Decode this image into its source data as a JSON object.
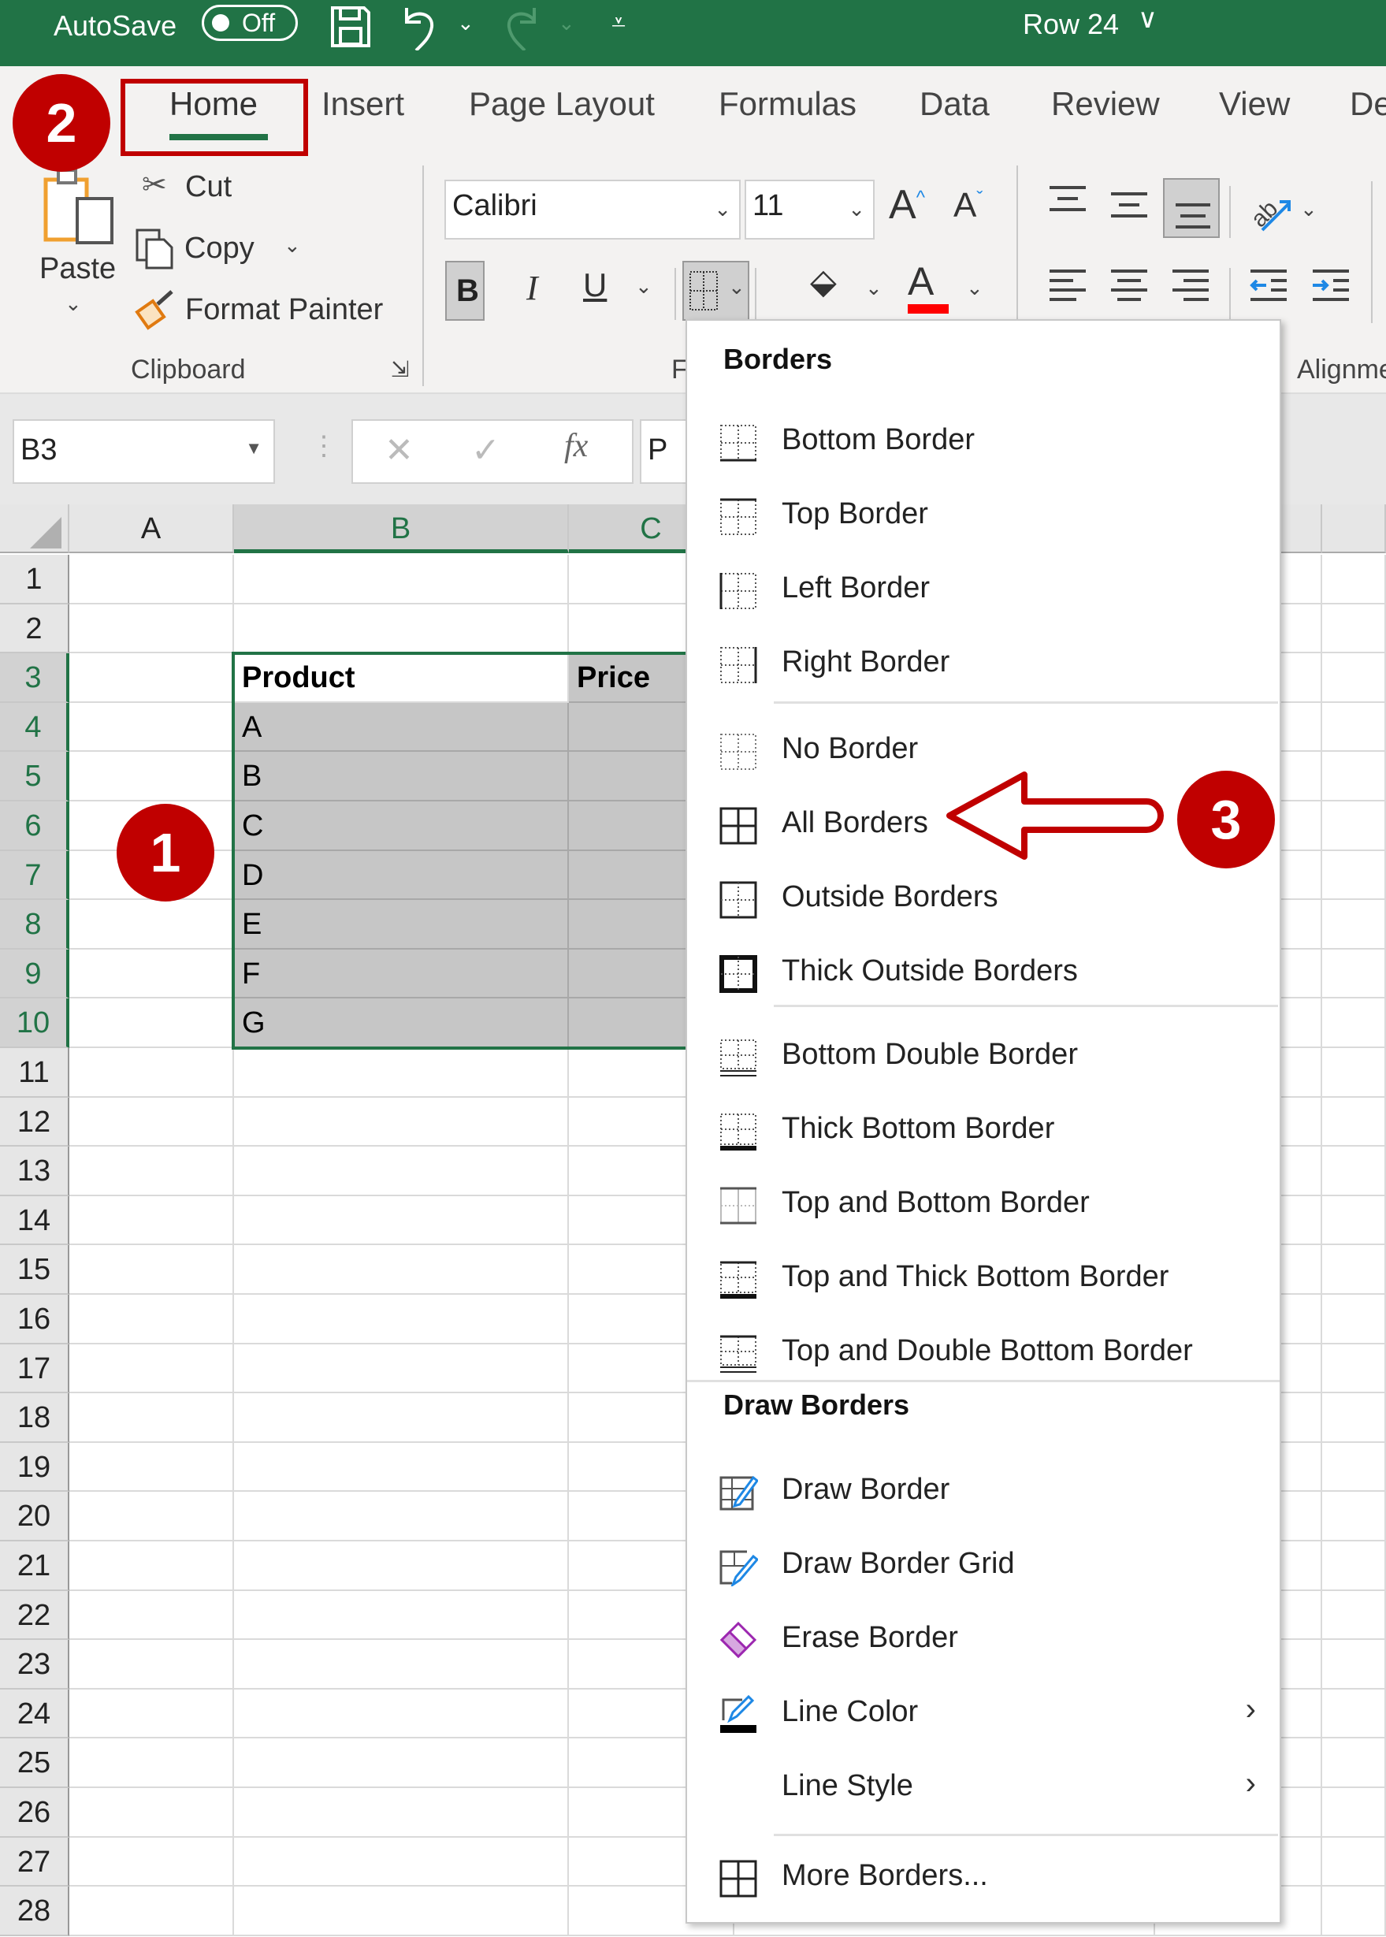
{
  "titlebar": {
    "autosave_label": "AutoSave",
    "autosave_state": "Off",
    "document_name": "Row 24",
    "colors": {
      "bar": "#217346"
    }
  },
  "tabs": [
    {
      "label": "Home",
      "active": true
    },
    {
      "label": "Insert"
    },
    {
      "label": "Page Layout"
    },
    {
      "label": "Formulas"
    },
    {
      "label": "Data"
    },
    {
      "label": "Review"
    },
    {
      "label": "View"
    },
    {
      "label": "De"
    }
  ],
  "ribbon": {
    "clipboard": {
      "paste": "Paste",
      "cut": "Cut",
      "copy": "Copy",
      "format_painter": "Format Painter",
      "group_label": "Clipboard"
    },
    "font": {
      "font_name": "Calibri",
      "font_size": "11",
      "bold": "B",
      "italic": "I",
      "underline": "U",
      "group_label": "F",
      "font_color": "#ff0000"
    },
    "alignment": {
      "group_label": "Alignme"
    }
  },
  "formula_bar": {
    "name_box": "B3",
    "fx": "fx",
    "content": "P"
  },
  "sheet": {
    "columns": [
      "A",
      "B",
      "C"
    ],
    "rows": [
      "1",
      "2",
      "3",
      "4",
      "5",
      "6",
      "7",
      "8",
      "9",
      "10",
      "11",
      "12",
      "13",
      "14",
      "15",
      "16",
      "17",
      "18",
      "19",
      "20",
      "21",
      "22",
      "23",
      "24",
      "25",
      "26",
      "27",
      "28"
    ],
    "table": {
      "header": [
        "Product",
        "Price"
      ],
      "products": [
        "A",
        "B",
        "C",
        "D",
        "E",
        "F",
        "G"
      ]
    }
  },
  "borders_menu": {
    "section1": "Borders",
    "items1": [
      {
        "label": "Bottom Border",
        "icon": "bottom-border-icon"
      },
      {
        "label": "Top Border",
        "icon": "top-border-icon"
      },
      {
        "label": "Left Border",
        "icon": "left-border-icon"
      },
      {
        "label": "Right Border",
        "icon": "right-border-icon"
      }
    ],
    "items2": [
      {
        "label": "No Border",
        "icon": "no-border-icon"
      },
      {
        "label": "All Borders",
        "icon": "all-borders-icon"
      },
      {
        "label": "Outside Borders",
        "icon": "outside-borders-icon"
      },
      {
        "label": "Thick Outside Borders",
        "icon": "thick-outside-borders-icon"
      }
    ],
    "items3": [
      {
        "label": "Bottom Double Border",
        "icon": "bottom-double-border-icon"
      },
      {
        "label": "Thick Bottom Border",
        "icon": "thick-bottom-border-icon"
      },
      {
        "label": "Top and Bottom Border",
        "icon": "top-and-bottom-border-icon"
      },
      {
        "label": "Top and Thick Bottom Border",
        "icon": "top-thick-bottom-border-icon"
      },
      {
        "label": "Top and Double Bottom Border",
        "icon": "top-double-bottom-border-icon"
      }
    ],
    "section2": "Draw Borders",
    "items4": [
      {
        "label": "Draw Border",
        "icon": "draw-border-icon"
      },
      {
        "label": "Draw Border Grid",
        "icon": "draw-border-grid-icon"
      },
      {
        "label": "Erase Border",
        "icon": "eraser-icon"
      },
      {
        "label": "Line Color",
        "icon": "line-color-icon",
        "submenu": true
      },
      {
        "label": "Line Style",
        "icon": "",
        "submenu": true
      }
    ],
    "more": {
      "label": "More Borders...",
      "icon": "more-borders-icon"
    }
  },
  "annotations": {
    "step1": "1",
    "step2": "2",
    "step3": "3",
    "color": "#c00000"
  }
}
